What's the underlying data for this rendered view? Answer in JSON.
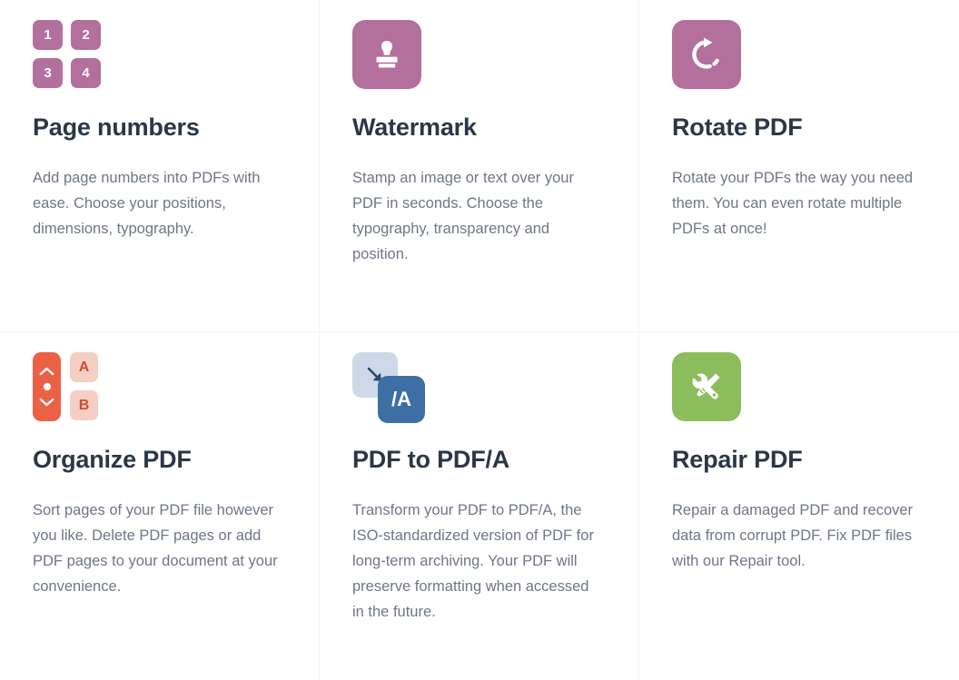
{
  "grid": {
    "columns": 3,
    "rows": 2,
    "divider_color": "#f2f4f7",
    "background": "#ffffff",
    "title_color": "#2b3648",
    "description_color": "#6e7687"
  },
  "tools": [
    {
      "id": "page-numbers",
      "title": "Page numbers",
      "description": "Add page numbers into PDFs with ease. Choose your positions, dimensions, typography.",
      "icon": "page-numbers-icon",
      "icon_color": "#b3709c",
      "cells": [
        "1",
        "2",
        "3",
        "4"
      ]
    },
    {
      "id": "watermark",
      "title": "Watermark",
      "description": "Stamp an image or text over your PDF in seconds. Choose the typography, transparency and position.",
      "icon": "stamp-icon",
      "icon_color": "#b3709c"
    },
    {
      "id": "rotate-pdf",
      "title": "Rotate PDF",
      "description": "Rotate your PDFs the way you need them. You can even rotate multiple PDFs at once!",
      "icon": "rotate-icon",
      "icon_color": "#b3709c"
    },
    {
      "id": "organize-pdf",
      "title": "Organize PDF",
      "description": "Sort pages of your PDF file however you like. Delete PDF pages or add PDF pages to your document at your convenience.",
      "icon": "sort-arrows-icon",
      "icon_color": "#ec6146",
      "letter_tile_color": "#f6cfc4",
      "letters": [
        "A",
        "B"
      ]
    },
    {
      "id": "pdf-to-pdfa",
      "title": "PDF to PDF/A",
      "description": "Transform your PDF to PDF/A, the ISO-standardized version of PDF for long-term archiving. Your PDF will preserve formatting when accessed in the future.",
      "icon": "pdfa-convert-icon",
      "icon_color": "#3d6fa5",
      "icon_back_color": "#cdd9e8",
      "badge_label": "/A"
    },
    {
      "id": "repair-pdf",
      "title": "Repair PDF",
      "description": "Repair a damaged PDF and recover data from corrupt PDF. Fix PDF files with our Repair tool.",
      "icon": "tools-wrench-icon",
      "icon_color": "#8cbd5c"
    }
  ]
}
